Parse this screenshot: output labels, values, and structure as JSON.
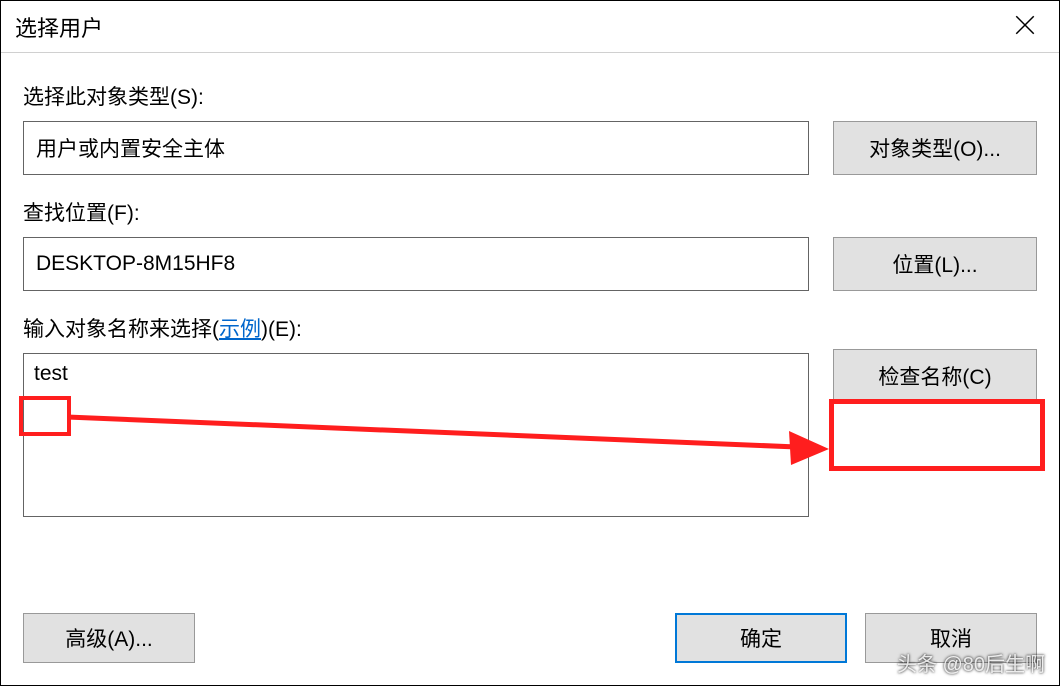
{
  "window": {
    "title": "选择用户"
  },
  "fields": {
    "object_type_label": "选择此对象类型(S):",
    "object_type_value": "用户或内置安全主体",
    "object_type_button": "对象类型(O)...",
    "location_label": "查找位置(F):",
    "location_value": "DESKTOP-8M15HF8",
    "location_button": "位置(L)...",
    "object_name_label_pre": "输入对象名称来选择(",
    "object_name_label_link": "示例",
    "object_name_label_post": ")(E):",
    "object_name_value": "test",
    "check_names_button": "检查名称(C)"
  },
  "footer": {
    "advanced_button": "高级(A)...",
    "ok_button": "确定",
    "cancel_button": "取消"
  },
  "watermark": "头条 @80后生啊"
}
